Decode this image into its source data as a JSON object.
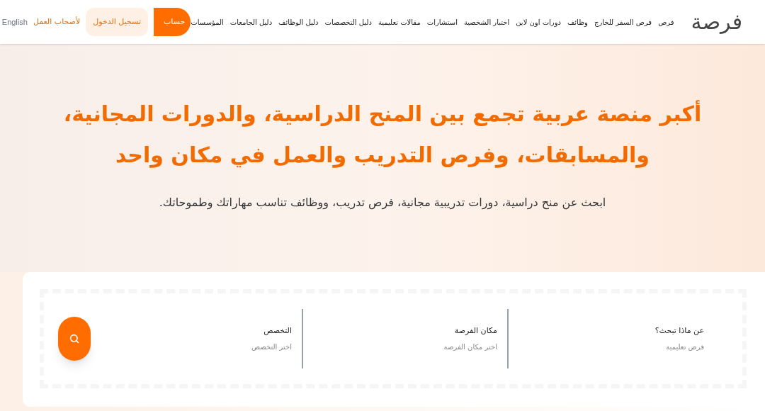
{
  "header": {
    "logo": "فرصة",
    "nav": [
      "فرص",
      "فرص السفر للخارج",
      "وظائف",
      "دورات اون لاين",
      "اختبار الشخصية",
      "استشارات",
      "مقالات تعليمية",
      "دليل التخصصات",
      "دليل الوظائف",
      "دليل الجامعات",
      "المؤسسات"
    ],
    "signup_button": "حساب",
    "login_button": "تسجيل الدخول",
    "employers_link": "لأصحاب العمل",
    "language": "English"
  },
  "hero": {
    "title": "أكبر منصة عربية تجمع بين المنح الدراسية، والدورات المجانية، والمسابقات، وفرص التدريب والعمل في مكان واحد",
    "subtitle": "ابحث عن منح دراسية، دورات تدريبية مجانية، فرص تدريب، ووظائف تناسب مهاراتك وطموحاتك."
  },
  "search": {
    "fields": [
      {
        "label": "عن ماذا تبحث؟",
        "placeholder": "فرص تعليمية"
      },
      {
        "label": "مكان الفرصة",
        "placeholder": "اختر مكان الفرصة"
      },
      {
        "label": "التخصص",
        "placeholder": "اختر التخصص"
      }
    ]
  }
}
